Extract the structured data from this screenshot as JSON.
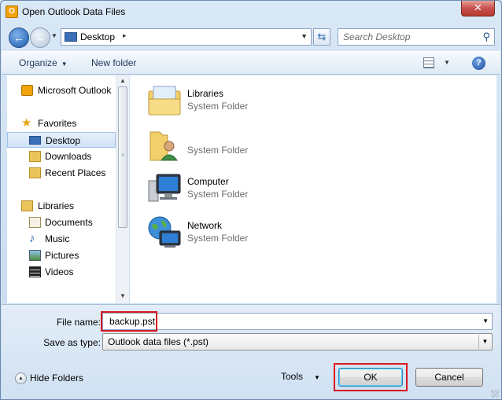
{
  "window": {
    "title": "Open Outlook Data Files",
    "close_glyph": "✕"
  },
  "address_bar": {
    "location": "Desktop",
    "separator": "▸",
    "search_placeholder": "Search Desktop"
  },
  "toolbar": {
    "organize_label": "Organize",
    "new_folder_label": "New folder"
  },
  "nav_pane": {
    "items": [
      {
        "label": "Microsoft Outlook",
        "icon": "outlook-icon"
      },
      {
        "label": "Favorites",
        "icon": "star-icon"
      },
      {
        "label": "Desktop",
        "icon": "desktop-icon",
        "selected": true
      },
      {
        "label": "Downloads",
        "icon": "downloads-icon"
      },
      {
        "label": "Recent Places",
        "icon": "recent-places-icon"
      },
      {
        "label": "Libraries",
        "icon": "libraries-icon"
      },
      {
        "label": "Documents",
        "icon": "documents-icon"
      },
      {
        "label": "Music",
        "icon": "music-icon"
      },
      {
        "label": "Pictures",
        "icon": "pictures-icon"
      },
      {
        "label": "Videos",
        "icon": "videos-icon"
      }
    ]
  },
  "content": {
    "items": [
      {
        "name": "Libraries",
        "type": "System Folder",
        "icon": "libraries-folder-icon"
      },
      {
        "name": "",
        "type": "System Folder",
        "icon": "user-folder-icon"
      },
      {
        "name": "Computer",
        "type": "System Folder",
        "icon": "computer-icon"
      },
      {
        "name": "Network",
        "type": "System Folder",
        "icon": "network-icon"
      }
    ]
  },
  "bottom": {
    "file_name_label": "File name:",
    "file_name_value": "backup.pst",
    "save_as_type_label": "Save as type:",
    "save_as_type_value": "Outlook data files (*.pst)",
    "hide_folders_label": "Hide Folders",
    "tools_label": "Tools",
    "ok_label": "OK",
    "cancel_label": "Cancel"
  },
  "colors": {
    "highlight": "#d71920",
    "accent": "#1e5cae"
  }
}
